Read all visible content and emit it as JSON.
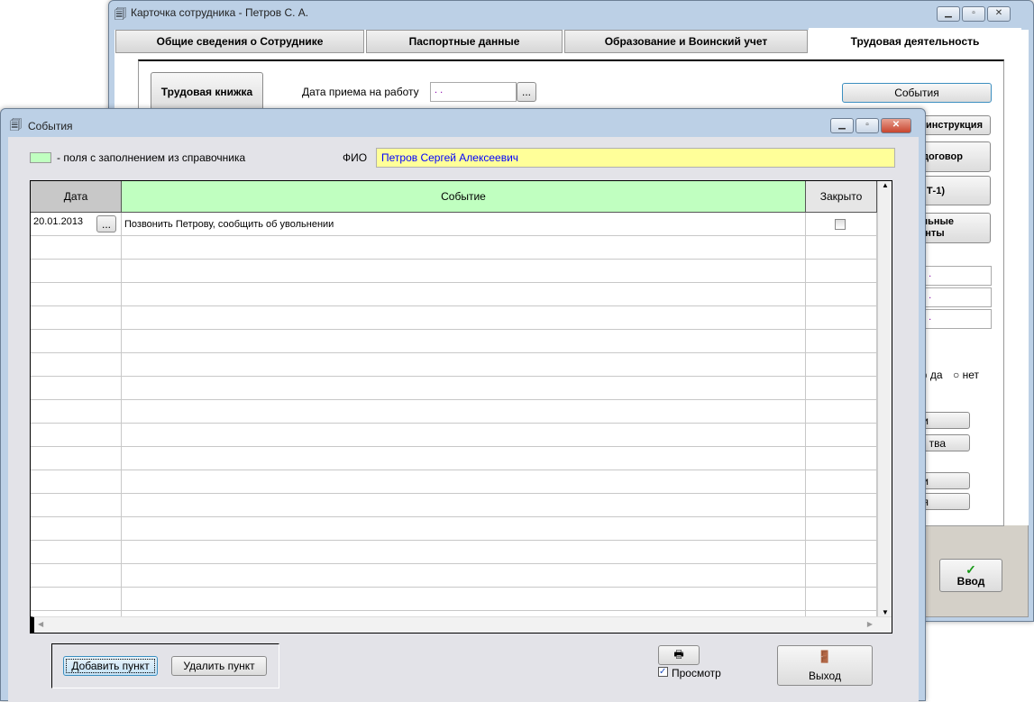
{
  "back_window": {
    "title": "Карточка сотрудника -  Петров С. А.",
    "tabs": [
      "Общие сведения о Сотруднике",
      "Паспортные данные",
      "Образование и Воинский учет",
      "Трудовая деятельность"
    ],
    "active_tab": 3,
    "labor_book_button": "Трудовая книжка",
    "hire_date_label": "Дата приема на работу",
    "hire_date_value": " .  .",
    "browse_label": "...",
    "events_button": "События",
    "right_buttons": [
      "инструкция",
      "договор",
      "Т-1)",
      "ельные\nнты"
    ],
    "date_fields": [
      " .  .",
      " .  .",
      " .  ."
    ],
    "radio_yes": "да",
    "radio_no": "нет",
    "small_buttons": [
      "и",
      "тва",
      "и",
      "я"
    ],
    "enter_button": "Ввод"
  },
  "events_window": {
    "title": "События",
    "legend_text": "- поля с заполнением из справочника",
    "legend_color": "#c0ffc0",
    "fio_label": "ФИО",
    "fio_value": "Петров Сергей Алексеевич",
    "fio_bg": "#ffff99",
    "fio_color": "#0000ff",
    "columns": [
      "Дата",
      "Событие",
      "Закрыто"
    ],
    "rows": [
      {
        "date": "20.01.2013",
        "event": "Позвонить Петрову, сообщить об увольнении",
        "closed": false
      }
    ],
    "browse_label": "...",
    "add_button": "Добавить пункт",
    "delete_button": "Удалить пункт",
    "preview_label": "Просмотр",
    "preview_checked": true,
    "exit_button": "Выход"
  }
}
